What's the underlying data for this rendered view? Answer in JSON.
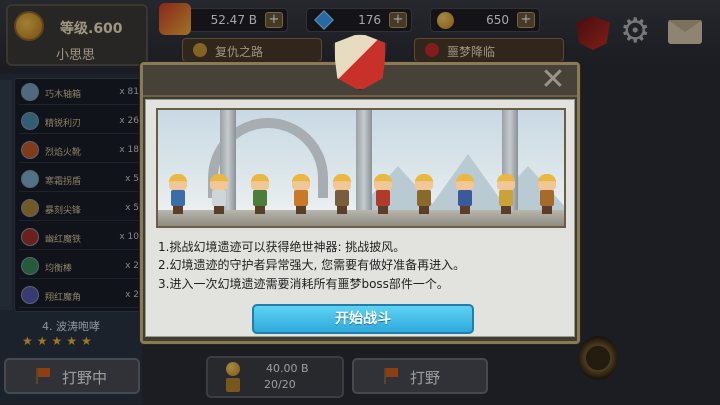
{
  "player": {
    "level": "等级.600",
    "name": "小思思"
  },
  "resources": {
    "gold": "52.47 B",
    "gems": "176",
    "coins": "650",
    "plus": "+"
  },
  "tabs": {
    "revenge": "复仇之路",
    "nightmare": "噩梦降临"
  },
  "items": [
    {
      "name": "巧木轴箱",
      "count": "x 81",
      "color": "#7aa2c4"
    },
    {
      "name": "精锐利刃",
      "count": "x 26",
      "color": "#4f8fb0"
    },
    {
      "name": "烈焰火靴",
      "count": "x 18",
      "color": "#c75a2a"
    },
    {
      "name": "寒霜拐盾",
      "count": "x 5",
      "color": "#7fb0d0"
    },
    {
      "name": "暴刻尖锋",
      "count": "x 5",
      "color": "#b0873a"
    },
    {
      "name": "幽红魔铁",
      "count": "x 10",
      "color": "#a2342f"
    },
    {
      "name": "均衡棒",
      "count": "x 2",
      "color": "#3a8a5a"
    },
    {
      "name": "翔红魔角",
      "count": "x 2",
      "color": "#5a5ab0"
    }
  ],
  "left_panel": {
    "title": "4. 波涛咆哮",
    "stars": "★★★★★"
  },
  "buttons": {
    "hunt_left": "打野中",
    "hunt_right": "打野"
  },
  "cost": {
    "amount": "40.00 B",
    "count": "20/20"
  },
  "modal": {
    "close": "✕",
    "line1": "1.挑战幻境遗迹可以获得绝世神器: 挑战披风。",
    "line2": "2.幻境遗迹的守护者异常强大, 您需要有做好准备再进入。",
    "line3": "3.进入一次幻境遗迹需要消耗所有噩梦boss部件一个。",
    "start_button": "开始战斗"
  },
  "scene": {
    "heroes": [
      {
        "armor": "#3b6ea8"
      },
      {
        "armor": "#cfd6da"
      },
      {
        "armor": "#4d7d3a"
      },
      {
        "armor": "#c97a28"
      },
      {
        "armor": "#7a5e3a"
      },
      {
        "armor": "#b23a2a"
      },
      {
        "armor": "#8a6a2a"
      },
      {
        "armor": "#3a5a9a"
      },
      {
        "armor": "#c9a23a"
      },
      {
        "armor": "#a86a2a"
      }
    ]
  },
  "colors": {
    "accent": "#2ea9db",
    "frame": "#8b7a54",
    "star": "#f2b736"
  }
}
